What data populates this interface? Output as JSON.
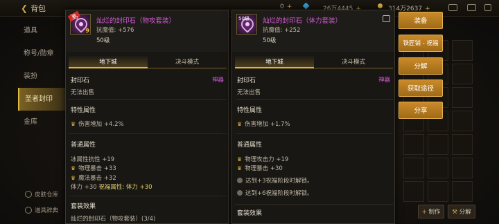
{
  "topbar": {
    "back_label": "背包",
    "currency_1": "0",
    "currency_2": "26万4445",
    "currency_3": "314万2637"
  },
  "leftnav": {
    "items": [
      "道具",
      "称号/勋章",
      "装扮",
      "圣者封印",
      "金库"
    ],
    "bottom": [
      "皮肤仓库",
      "道具辞典"
    ]
  },
  "left_popup": {
    "level_badge": "50",
    "badge_text": "神",
    "badge_num": "9",
    "name": "灿烂的封印石（物攻套装）",
    "stat": "抗魔值: +576",
    "level": "50级",
    "tabs": [
      "地下城",
      "决斗模式"
    ],
    "item_type": "封印石",
    "grade": "神器",
    "trade": "无法出售",
    "special_title": "特性属性",
    "special": [
      "伤害增加 +4.2%"
    ],
    "common_title": "普通属性",
    "common_plain": "冰属性抗性 +19",
    "common_crowned": [
      "物理暴击 +33",
      "魔法暴击 +32"
    ],
    "blessing_prefix": "体力 +30",
    "blessing_main": "祝福属性: 体力 +30",
    "set_title": "套装效果",
    "set_line": "灿烂的封印石（物攻套装）(3/4)"
  },
  "right_popup": {
    "level_badge": "50级",
    "name": "灿烂的封印石（体力套装）",
    "stat": "抗魔值: +252",
    "level": "50级",
    "tabs": [
      "地下城",
      "决斗模式"
    ],
    "item_type": "封印石",
    "grade": "神器",
    "trade": "无法出售",
    "special_title": "特性属性",
    "special": [
      "伤害增加 +1.7%"
    ],
    "common_title": "普通属性",
    "common_crowned": [
      "物理攻击力 +19",
      "物理暴击 +30"
    ],
    "locked": [
      "达到+3祝福阶段时解锁。",
      "达到+6祝福阶段时解锁。"
    ],
    "set_title": "套装效果"
  },
  "buttons": {
    "equip": "装备",
    "smith": "铁匠铺 - 祝福",
    "decompose": "分解",
    "source": "获取途径",
    "share": "分享"
  },
  "bottom_buttons": {
    "craft": "制作",
    "decompose": "分解"
  },
  "colors": {
    "accent": "#c98a2a",
    "epic": "#d45ad8",
    "gold": "#e3b83e"
  }
}
